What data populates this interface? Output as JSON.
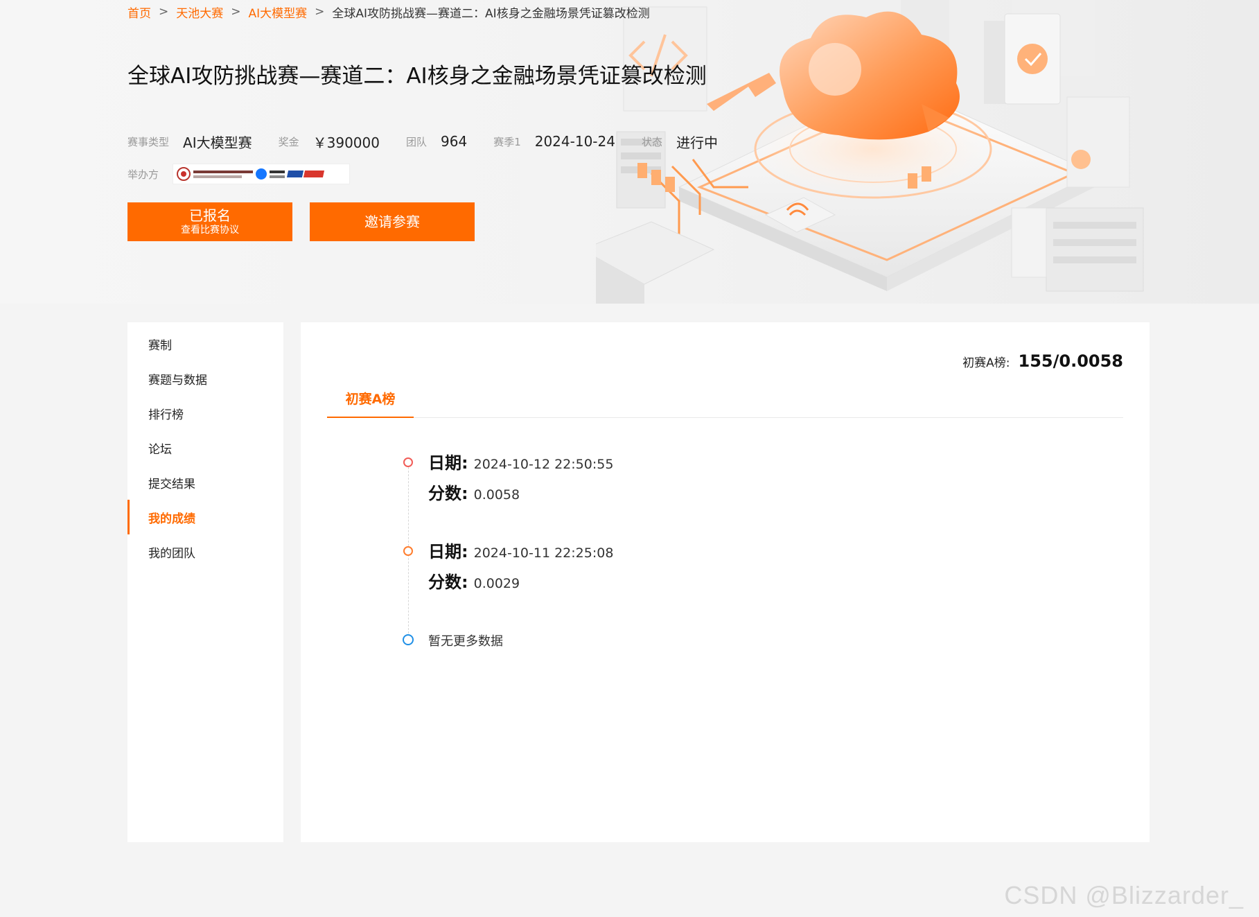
{
  "breadcrumb": {
    "items": [
      "首页",
      "天池大赛",
      "AI大模型赛"
    ],
    "separator": ">",
    "current": "全球AI攻防挑战赛—赛道二：AI核身之金融场景凭证篡改检测"
  },
  "competition": {
    "title": "全球AI攻防挑战赛—赛道二：AI核身之金融场景凭证篡改检测",
    "type_label": "赛事类型",
    "type_value": "AI大模型赛",
    "prize_label": "奖金",
    "prize_value": "￥390000",
    "teams_label": "团队",
    "teams_value": "964",
    "season_label": "赛季1",
    "season_value": "2024-10-24",
    "status_label": "状态",
    "status_value": "进行中",
    "organizer_label": "举办方"
  },
  "actions": {
    "registered_label": "已报名",
    "registered_sub": "查看比赛协议",
    "invite_label": "邀请参赛"
  },
  "sidebar": {
    "items": [
      {
        "label": "赛制"
      },
      {
        "label": "赛题与数据"
      },
      {
        "label": "排行榜"
      },
      {
        "label": "论坛"
      },
      {
        "label": "提交结果"
      },
      {
        "label": "我的成绩",
        "active": true
      },
      {
        "label": "我的团队"
      }
    ]
  },
  "main": {
    "summary_label": "初赛A榜:",
    "summary_value": "155/0.0058",
    "tabs": [
      {
        "label": "初赛A榜",
        "active": true
      }
    ],
    "records": [
      {
        "date_key": "日期:",
        "date": "2024-10-12 22:50:55",
        "score_key": "分数:",
        "score": "0.0058"
      },
      {
        "date_key": "日期:",
        "date": "2024-10-11 22:25:08",
        "score_key": "分数:",
        "score": "0.0029"
      }
    ],
    "empty_text": "暂无更多数据"
  },
  "watermark": "CSDN @Blizzarder_",
  "colors": {
    "accent": "#ff6a00",
    "background": "#f4f4f4",
    "panel": "#ffffff",
    "dot_red": "#f15c57",
    "dot_orange": "#ff7d2e",
    "dot_blue": "#1f8fe6"
  }
}
